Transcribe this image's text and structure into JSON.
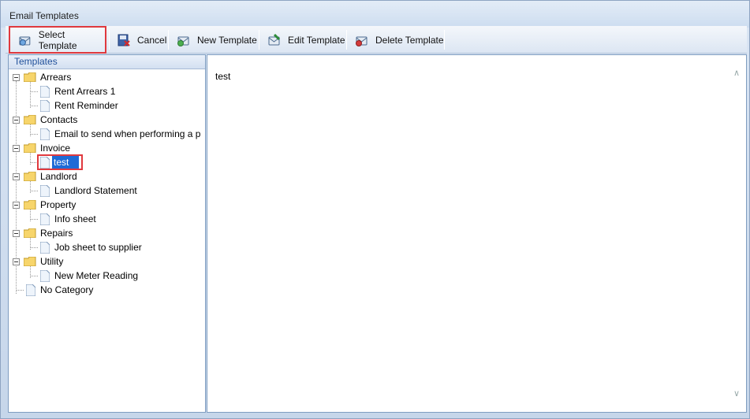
{
  "window": {
    "title": "Email Templates"
  },
  "toolbar": {
    "select_label": "Select Template",
    "cancel_label": "Cancel",
    "new_label": "New Template",
    "edit_label": "Edit Template",
    "delete_label": "Delete Template"
  },
  "templates_panel": {
    "header": "Templates"
  },
  "tree": {
    "cat_arrears": "Arrears",
    "item_rent_arrears_1": "Rent Arrears 1",
    "item_rent_reminder": "Rent Reminder",
    "cat_contacts": "Contacts",
    "item_email_performing": "Email to send when performing a p",
    "cat_invoice": "Invoice",
    "item_test": "test",
    "cat_landlord": "Landlord",
    "item_landlord_statement": "Landlord Statement",
    "cat_property": "Property",
    "item_info_sheet": "Info sheet",
    "cat_repairs": "Repairs",
    "item_job_sheet": "Job sheet to supplier",
    "cat_utility": "Utility",
    "item_new_meter": "New Meter Reading",
    "no_category": "No Category"
  },
  "preview": {
    "text": "test"
  },
  "colors": {
    "accent": "#1f6bd6",
    "highlight_box": "#e0393e",
    "header_text": "#1f4f9a"
  }
}
